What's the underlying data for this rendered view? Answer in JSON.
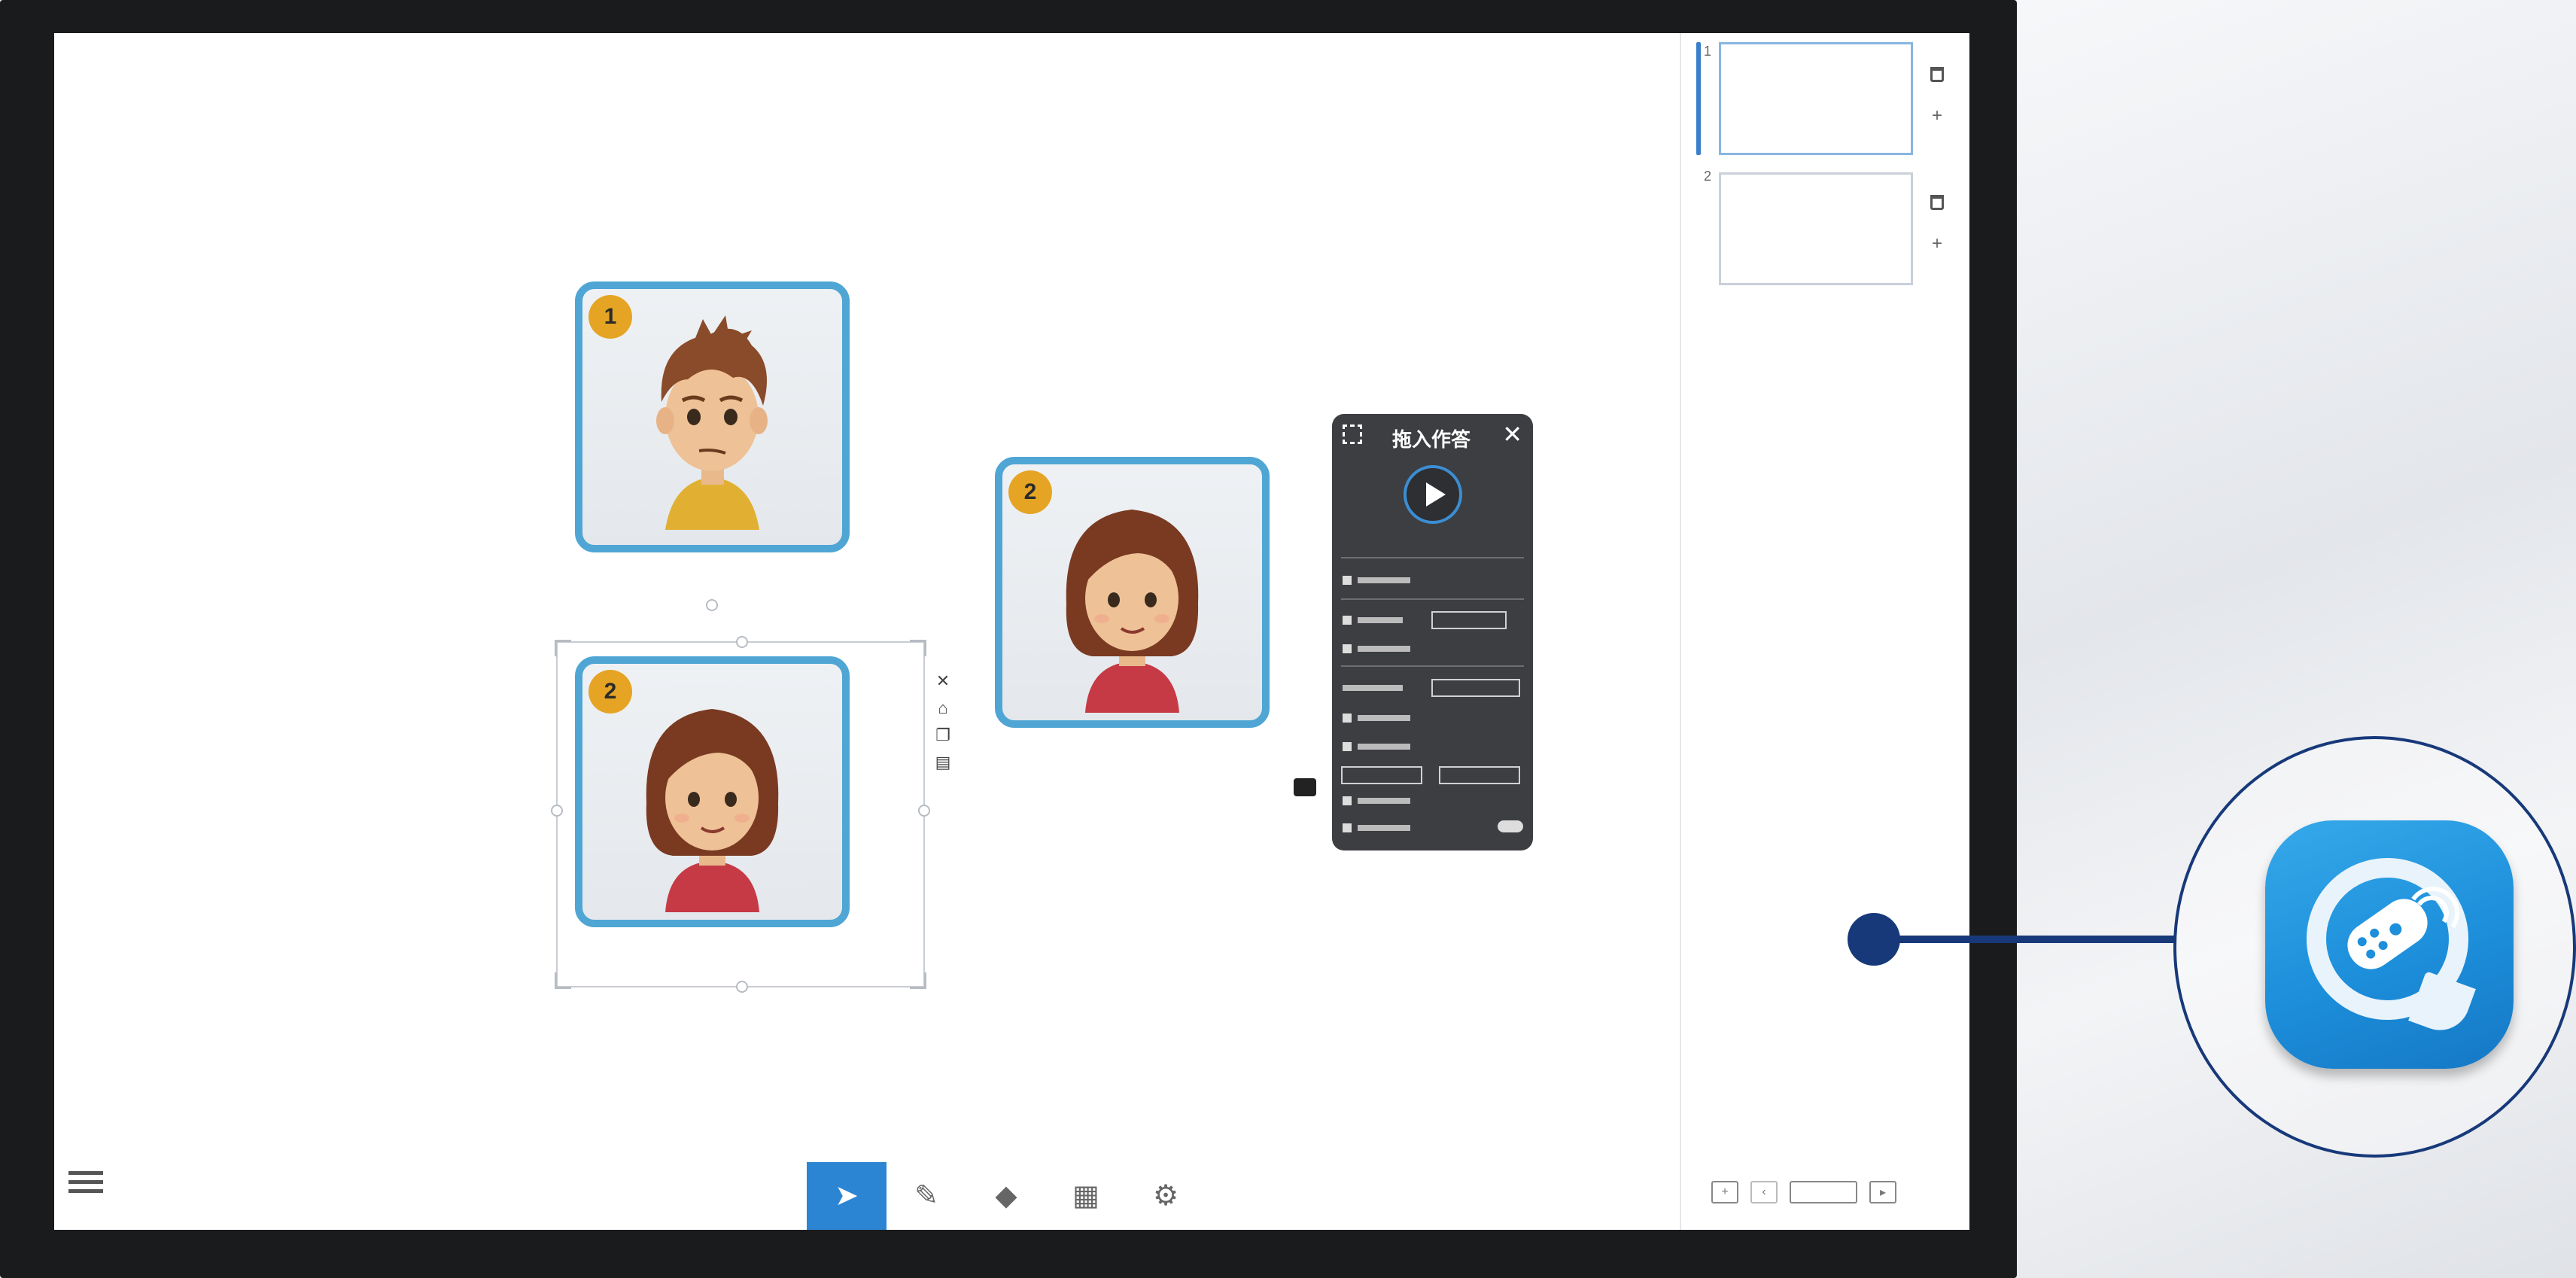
{
  "dialog": {
    "title": "拖入作答"
  },
  "cards": [
    {
      "badge": "1"
    },
    {
      "badge": "2"
    },
    {
      "badge": "2"
    }
  ],
  "slides": [
    {
      "number": "1"
    },
    {
      "number": "2"
    }
  ],
  "colors": {
    "accent": "#2c85d2",
    "card_border": "#4fa6d4",
    "badge": "#e5a423",
    "connector": "#17397a",
    "dialog_bg": "#3c3e42"
  },
  "icons": {
    "remote_app": "remote-control-app-icon",
    "menu": "hamburger-icon",
    "select": "cursor-arrow-icon",
    "pen": "pen-icon",
    "eraser": "eraser-icon",
    "tools": "toolbox-icon",
    "settings": "gear-icon",
    "play": "play-icon",
    "close": "close-icon",
    "trash": "trash-icon",
    "add": "plus-icon"
  }
}
